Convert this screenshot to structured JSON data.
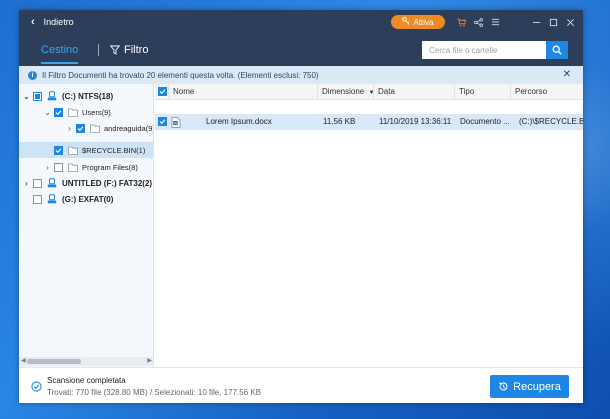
{
  "titlebar": {
    "back_label": "Indietro",
    "activate_label": "Attiva",
    "accent_color": "#f08a24",
    "icons": [
      "cart-icon",
      "share-icon",
      "menu-icon",
      "minimize-icon",
      "maximize-icon",
      "close-icon"
    ]
  },
  "header": {
    "tab_active": "Cestino",
    "tab_filter": "Filtro",
    "search_placeholder": "Cerca file o cartelle"
  },
  "info": {
    "message": "Il Filtro Documenti ha trovato 20 elementi questa volta. (Elementi esclusi: 750)"
  },
  "tree": {
    "items": [
      {
        "label": "(C:) NTFS(18)",
        "type": "drive",
        "expanded": true,
        "check": "partial"
      },
      {
        "label": "Users(9)",
        "type": "folder",
        "expanded": true,
        "check": "checked"
      },
      {
        "label": "andreaguida(9)",
        "type": "folder",
        "expanded": false,
        "check": "checked"
      },
      {
        "label": "$RECYCLE.BIN(1)",
        "type": "folder",
        "expanded": false,
        "check": "checked",
        "selected": true
      },
      {
        "label": "Program Files(8)",
        "type": "folder",
        "expanded": false,
        "check": "unchecked"
      },
      {
        "label": "UNTITLED  (F:) FAT32(2)",
        "type": "drive",
        "expanded": false,
        "check": "unchecked"
      },
      {
        "label": "(G:) EXFAT(0)",
        "type": "drive",
        "expanded": false,
        "check": "unchecked"
      }
    ]
  },
  "table": {
    "columns": [
      "Nome",
      "Dimensione",
      "Data",
      "Tipo",
      "Percorso"
    ],
    "rows": [
      {
        "name": "Lorem Ipsum.docx",
        "size": "11.56 KB",
        "date": "11/10/2019 13:36:11",
        "type": "Documento ...",
        "path": "(C:)\\$RECYCLE.BIN\\..."
      }
    ]
  },
  "footer": {
    "status_title": "Scansione completata",
    "status_detail": "Trovati: 770 file (328.80 MB) / Selezionati: 10 file, 177.56 KB",
    "recover_label": "Recupera"
  }
}
